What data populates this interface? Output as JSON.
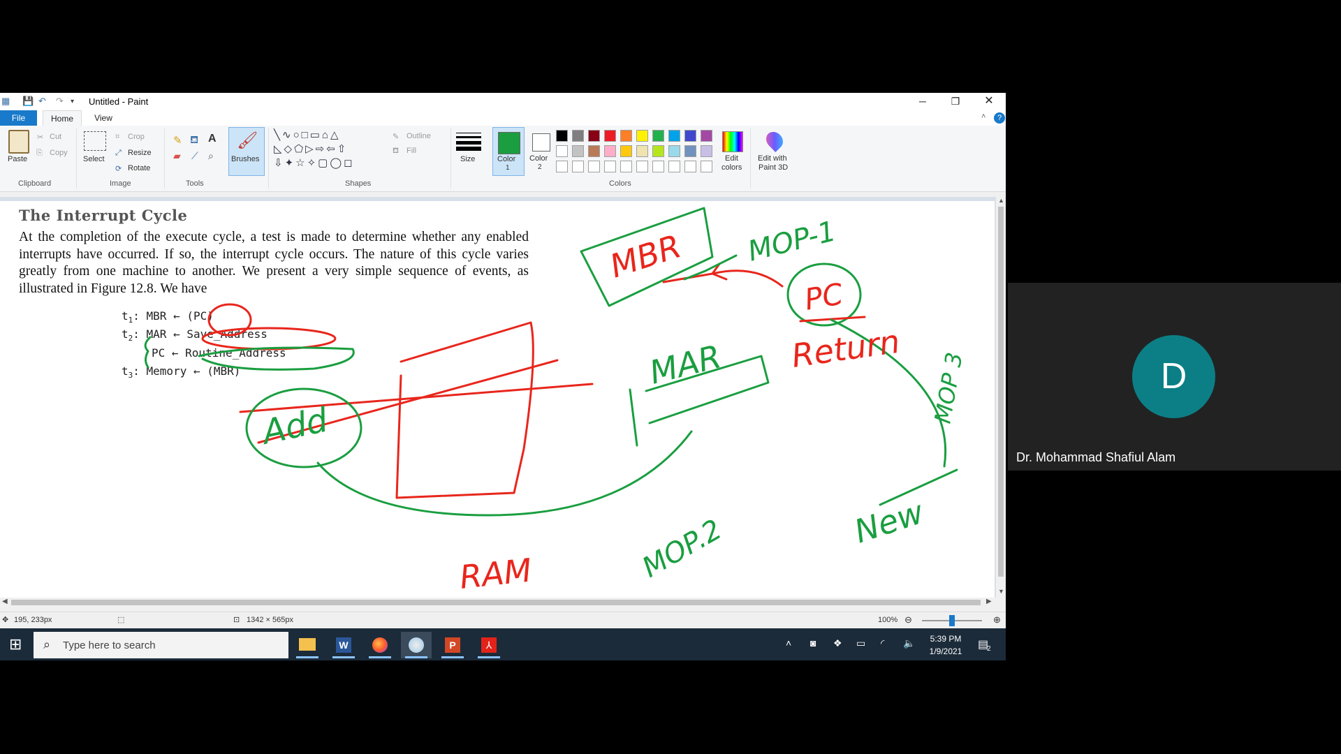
{
  "window": {
    "title": "Untitled - Paint"
  },
  "menu": {
    "file": "File",
    "home": "Home",
    "view": "View"
  },
  "ribbon": {
    "clipboard": {
      "paste": "Paste",
      "cut": "Cut",
      "copy": "Copy",
      "label": "Clipboard"
    },
    "image": {
      "select": "Select",
      "crop": "Crop",
      "resize": "Resize",
      "rotate": "Rotate",
      "label": "Image"
    },
    "tools": {
      "label": "Tools"
    },
    "brushes": {
      "label": "Brushes"
    },
    "shapes": {
      "outline": "Outline",
      "fill": "Fill",
      "label": "Shapes"
    },
    "size": {
      "label": "Size"
    },
    "colors": {
      "color1": "Color",
      "color1_num": "1",
      "color2": "Color",
      "color2_num": "2",
      "edit_colors": "Edit",
      "edit_colors2": "colors",
      "edit_3d": "Edit with",
      "edit_3d2": "Paint 3D",
      "label": "Colors",
      "color1_value": "#1a9e40",
      "color2_value": "#ffffff",
      "palette_row1": [
        "#000000",
        "#7f7f7f",
        "#880015",
        "#ed1c24",
        "#ff7f27",
        "#fff200",
        "#22b14c",
        "#00a2e8",
        "#3f48cc",
        "#a349a4"
      ],
      "palette_row2": [
        "#ffffff",
        "#c3c3c3",
        "#b97a57",
        "#ffaec9",
        "#ffc90e",
        "#efe4b0",
        "#b5e61d",
        "#99d9ea",
        "#7092be",
        "#c8bfe7"
      ]
    }
  },
  "document": {
    "title": "The Interrupt Cycle",
    "paragraph": "At the completion of the execute cycle, a test is made to determine whether any enabled interrupts have occurred. If so, the interrupt cycle occurs. The nature of this cycle varies greatly from one machine to another. We present a very simple sequence of events, as illustrated in Figure 12.8. We have",
    "code": {
      "t1_label": "t",
      "t1_sub": "1",
      "t1": ": MBR ← (PC)",
      "t2_label": "t",
      "t2_sub": "2",
      "t2a": ": MAR ← Save_Address",
      "t2b": "PC ← Routine_Address",
      "t3_label": "t",
      "t3_sub": "3",
      "t3": ": Memory ← (MBR)"
    }
  },
  "annotations": {
    "mbr": "MBR",
    "mop1": "MOP-1",
    "pc": "PC",
    "return": "Return",
    "mar": "MAR",
    "add": "Add",
    "ram": "RAM",
    "mop2": "MOP.2",
    "mop3": "MOP 3",
    "new": "New",
    "green": "#1a9e40",
    "red": "#e8261c"
  },
  "status": {
    "cursor": "195, 233px",
    "canvas_size": "1342 × 565px",
    "zoom": "100%",
    "zoom_fraction": 0.5
  },
  "taskbar": {
    "search_placeholder": "Type here to search",
    "time": "5:39 PM",
    "date": "1/9/2021",
    "notifications": "2"
  },
  "meeting": {
    "avatar_letter": "D",
    "participant_name": "Dr. Mohammad Shafiul Alam"
  }
}
